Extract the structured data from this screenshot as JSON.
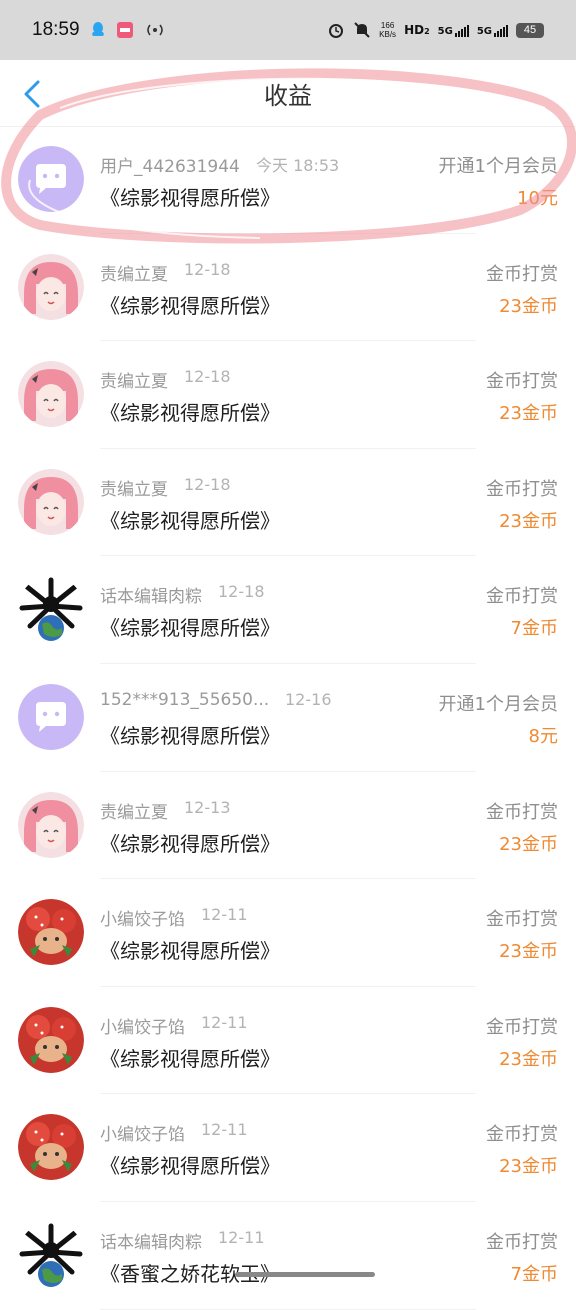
{
  "status_bar": {
    "time": "18:59",
    "speed": "166",
    "speed_unit": "KB/s",
    "hd": "HD",
    "hd_sub": "2",
    "net1": "5G",
    "net2": "5G",
    "battery": "45"
  },
  "header": {
    "title": "收益"
  },
  "records": [
    {
      "sender": "用户_442631944",
      "date": "今天 18:53",
      "work": "《综影视得愿所偿》",
      "type": "开通1个月会员",
      "amount": "10元",
      "avatar": "chat"
    },
    {
      "sender": "责编立夏",
      "date": "12-18",
      "work": "《综影视得愿所偿》",
      "type": "金币打赏",
      "amount": "23金币",
      "avatar": "anime-girl"
    },
    {
      "sender": "责编立夏",
      "date": "12-18",
      "work": "《综影视得愿所偿》",
      "type": "金币打赏",
      "amount": "23金币",
      "avatar": "anime-girl"
    },
    {
      "sender": "责编立夏",
      "date": "12-18",
      "work": "《综影视得愿所偿》",
      "type": "金币打赏",
      "amount": "23金币",
      "avatar": "anime-girl"
    },
    {
      "sender": "话本编辑肉粽",
      "date": "12-18",
      "work": "《综影视得愿所偿》",
      "type": "金币打赏",
      "amount": "7金币",
      "avatar": "earth"
    },
    {
      "sender": "152***913_55650...",
      "date": "12-16",
      "work": "《综影视得愿所偿》",
      "type": "开通1个月会员",
      "amount": "8元",
      "avatar": "chat"
    },
    {
      "sender": "责编立夏",
      "date": "12-13",
      "work": "《综影视得愿所偿》",
      "type": "金币打赏",
      "amount": "23金币",
      "avatar": "anime-girl"
    },
    {
      "sender": "小编饺子馅",
      "date": "12-11",
      "work": "《综影视得愿所偿》",
      "type": "金币打赏",
      "amount": "23金币",
      "avatar": "strawberry"
    },
    {
      "sender": "小编饺子馅",
      "date": "12-11",
      "work": "《综影视得愿所偿》",
      "type": "金币打赏",
      "amount": "23金币",
      "avatar": "strawberry"
    },
    {
      "sender": "小编饺子馅",
      "date": "12-11",
      "work": "《综影视得愿所偿》",
      "type": "金币打赏",
      "amount": "23金币",
      "avatar": "strawberry"
    },
    {
      "sender": "话本编辑肉粽",
      "date": "12-11",
      "work": "《香蜜之娇花软玉》",
      "type": "金币打赏",
      "amount": "7金币",
      "avatar": "earth"
    }
  ],
  "colors": {
    "amount": "#ef8a33",
    "accent": "#2d9cf0",
    "chat_avatar": "#c9b8f6"
  }
}
